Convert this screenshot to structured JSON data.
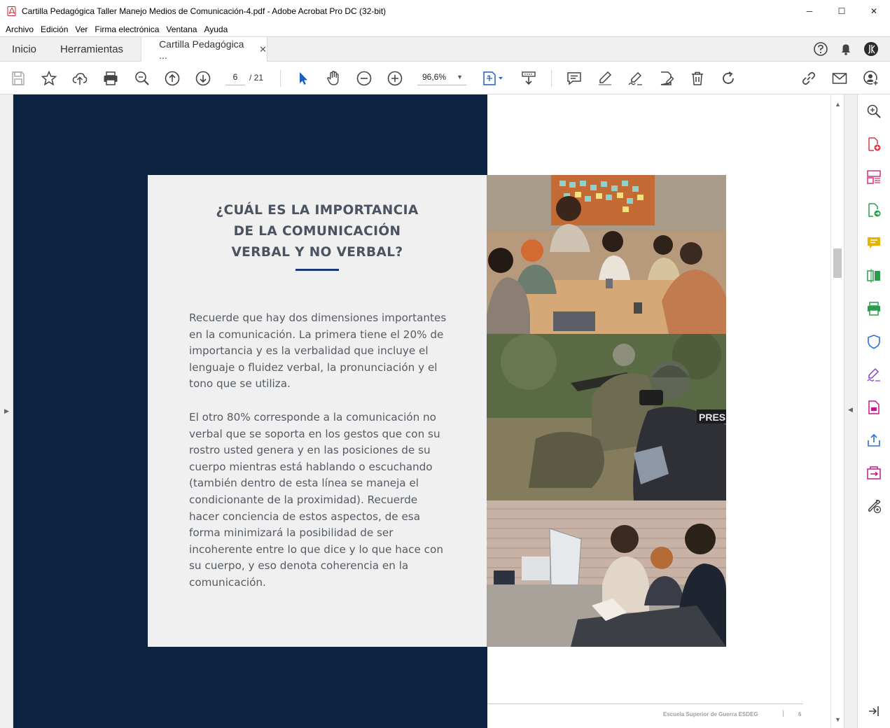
{
  "window": {
    "title": "Cartilla Pedagógica Taller Manejo Medios de Comunicación-4.pdf - Adobe Acrobat Pro DC (32-bit)",
    "controls": {
      "minimize": "─",
      "maximize": "☐",
      "close": "✕"
    }
  },
  "menu": [
    "Archivo",
    "Edición",
    "Ver",
    "Firma electrónica",
    "Ventana",
    "Ayuda"
  ],
  "tabs": {
    "home": "Inicio",
    "tools": "Herramientas",
    "document": "Cartilla Pedagógica ...",
    "close": "✕"
  },
  "toolbar": {
    "page_current": "6",
    "page_total": "/ 21",
    "zoom": "96,6%",
    "zoom_caret": "▼"
  },
  "document": {
    "heading_lines": [
      "¿CUÁL ES LA IMPORTANCIA",
      "DE LA COMUNICACIÓN",
      "VERBAL Y NO VERBAL?"
    ],
    "paragraph1": "Recuerde que hay dos dimensiones importantes en la comunicación. La primera tiene el 20% de importancia y es la verbalidad que incluye el lenguaje o fluidez verbal, la pronunciación y el tono que se utiliza.",
    "paragraph2": "El otro 80% corresponde a la comunicación no verbal que se soporta en los gestos que con su rostro usted genera y en las posiciones de su cuerpo mientras está hablando o escuchando (también dentro de esta línea se maneja el condicionante de la proximidad). Recuerde hacer conciencia de estos aspectos, de esa forma minimizará la posibilidad de ser incoherente entre lo que dice y lo que hace con su cuerpo, y eso denota coherencia en la comunicación.",
    "photo_badge": "PRES",
    "footer_text": "Escuela  Superior de Guerra ESDEG",
    "footer_sep": "|",
    "footer_page": "6"
  },
  "colors": {
    "navy": "#0c2341",
    "accent_rule": "#1c3a7a",
    "tool_red": "#e0383e",
    "tool_pink": "#d4307a",
    "tool_green": "#2a9d4b",
    "tool_yellow": "#e6b400",
    "tool_blue": "#2c6fd6",
    "tool_purple": "#8a3fd1",
    "tool_magenta": "#c2188f"
  }
}
